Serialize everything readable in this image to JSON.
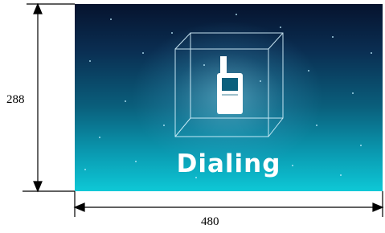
{
  "screen": {
    "label": "Dialing",
    "icon": "phone-icon"
  },
  "dimensions": {
    "height": "288",
    "width": "480"
  },
  "colors": {
    "screen_top": "#06132e",
    "screen_bottom": "#0ec8d6",
    "text": "#ffffff"
  }
}
